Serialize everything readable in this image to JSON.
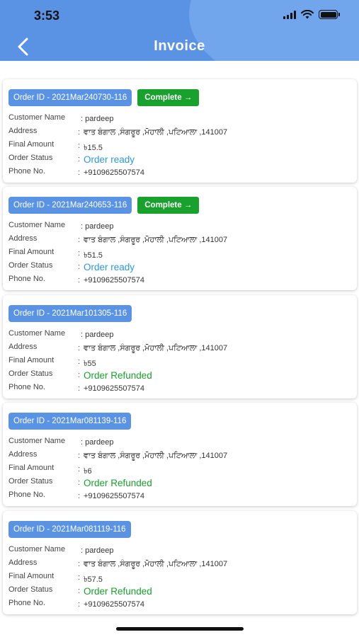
{
  "status_bar": {
    "time": "3:53"
  },
  "header": {
    "title": "Invoice"
  },
  "labels": {
    "customer_name": "Customer Name",
    "address": "Address",
    "final_amount": "Final Amount",
    "order_status": "Order Status",
    "phone": "Phone No.",
    "colon": ":"
  },
  "orders": [
    {
      "order_id": "Order ID - 2021Mar240730-116",
      "complete_label": "Complete →",
      "customer_name": ": pardeep",
      "address": "ਵਾਤ ਬੰਗਾਲ ,ਸੰਗਰੂਰ ,ਮੋਹਾਲੀ ,ਪਟਿਆਲਾ ,141007",
      "final_amount": "৳15.5",
      "order_status": "Order ready",
      "status_type": "ready",
      "phone": "+9109625507574"
    },
    {
      "order_id": "Order ID - 2021Mar240653-116",
      "complete_label": "Complete →",
      "customer_name": ": pardeep",
      "address": "ਵਾਤ ਬੰਗਾਲ ,ਸੰਗਰੂਰ ,ਮੋਹਾਲੀ ,ਪਟਿਆਲਾ ,141007",
      "final_amount": "৳51.5",
      "order_status": "Order ready",
      "status_type": "ready",
      "phone": "+9109625507574"
    },
    {
      "order_id": "Order ID - 2021Mar101305-116",
      "customer_name": ": pardeep",
      "address": "ਵਾਤ ਬੰਗਾਲ ,ਸੰਗਰੂਰ ,ਮੋਹਾਲੀ ,ਪਟਿਆਲਾ ,141007",
      "final_amount": "৳55",
      "order_status": "Order Refunded",
      "status_type": "refunded",
      "phone": "+9109625507574"
    },
    {
      "order_id": "Order ID - 2021Mar081139-116",
      "customer_name": ": pardeep",
      "address": "ਵਾਤ ਬੰਗਾਲ ,ਸੰਗਰੂਰ ,ਮੋਹਾਲੀ ,ਪਟਿਆਲਾ ,141007",
      "final_amount": "৳6",
      "order_status": "Order Refunded",
      "status_type": "refunded",
      "phone": "+9109625507574"
    },
    {
      "order_id": "Order ID - 2021Mar081119-116",
      "customer_name": ": pardeep",
      "address": "ਵਾਤ ਬੰਗਾਲ ,ਸੰਗਰੂਰ ,ਮੋਹਾਲੀ ,ਪਟਿਆਲਾ ,141007",
      "final_amount": "৳57.5",
      "order_status": "Order Refunded",
      "status_type": "refunded",
      "phone": "+9109625507574"
    }
  ],
  "colors": {
    "header": "#5a93e4",
    "complete": "#19a12d",
    "status_ready": "#2b97e0",
    "status_refunded": "#19a12d"
  }
}
